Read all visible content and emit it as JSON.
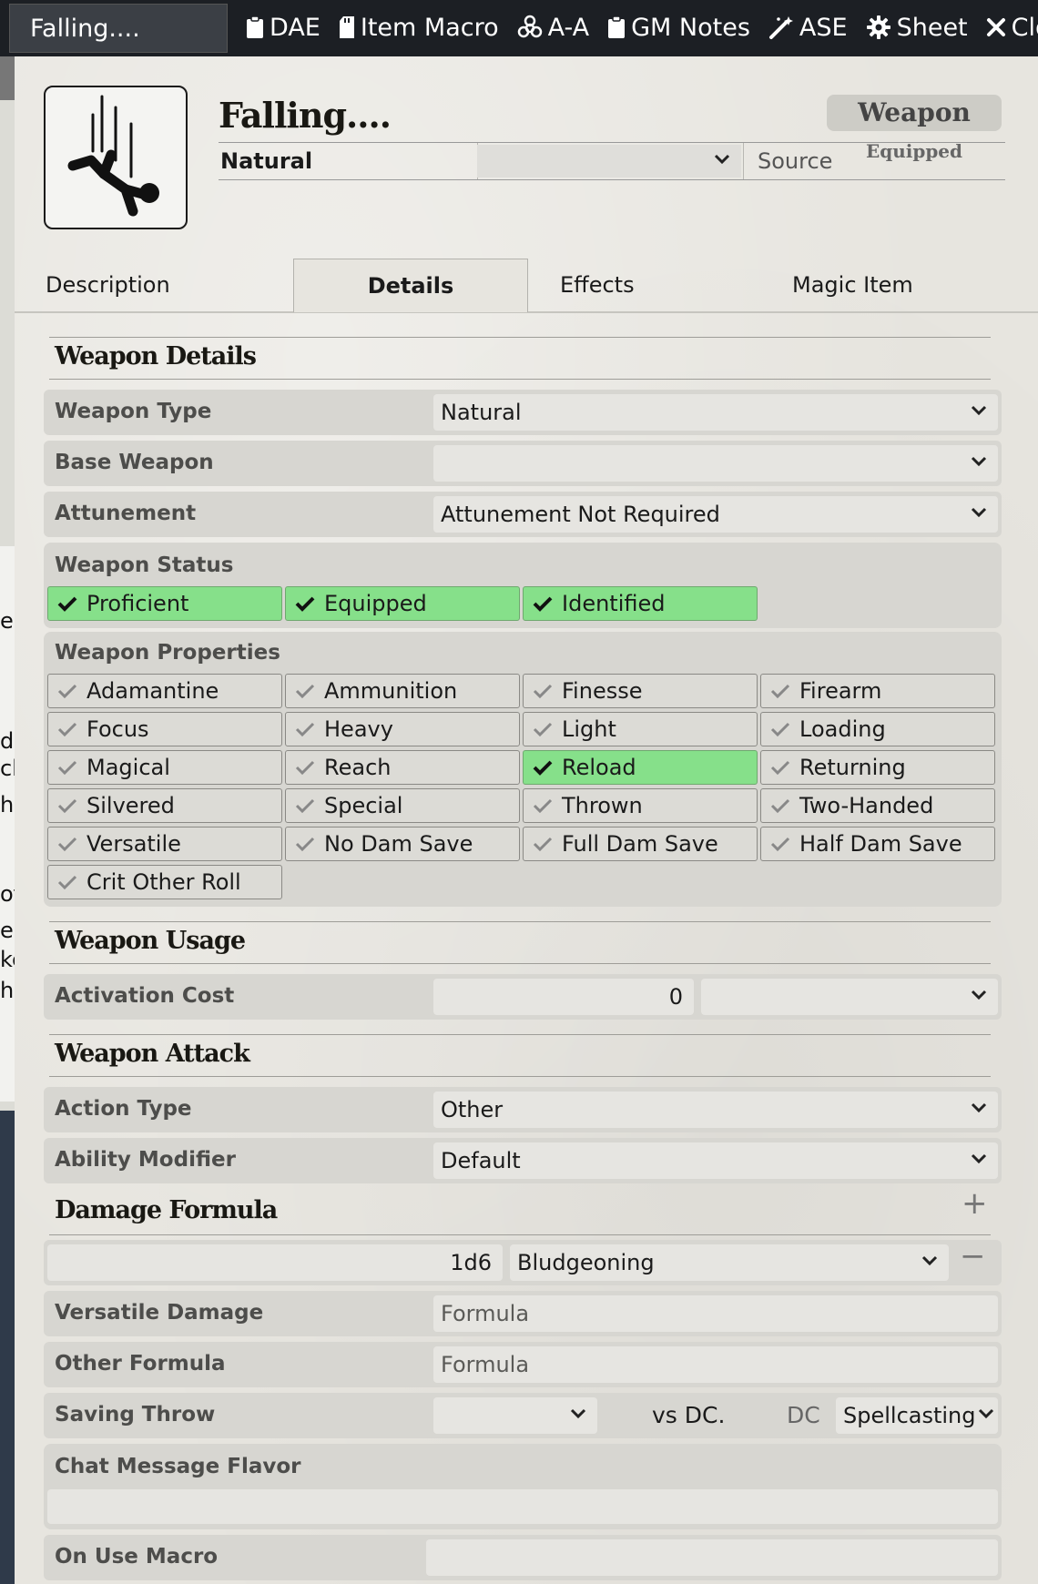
{
  "window": {
    "title": "Falling....",
    "header_buttons": [
      {
        "label": "DAE",
        "icon": "clipboard-icon"
      },
      {
        "label": "Item Macro",
        "icon": "sd-card-icon"
      },
      {
        "label": "A-A",
        "icon": "biohazard-icon"
      },
      {
        "label": "GM Notes",
        "icon": "clipboard-icon"
      },
      {
        "label": "ASE",
        "icon": "magic-wand-icon"
      },
      {
        "label": "Sheet",
        "icon": "gear-icon"
      },
      {
        "label": "Close",
        "icon": "close-icon"
      }
    ]
  },
  "background": {
    "fragments": [
      "e",
      "di",
      "ch",
      "he",
      "ot",
      "e.",
      "ke",
      "hu"
    ]
  },
  "item": {
    "name": "Falling....",
    "type_label": "Weapon",
    "status_label": "Equipped",
    "subtype": "Natural",
    "rarity_value": "",
    "source_placeholder": "Source",
    "portrait_icon": "falling-person-icon"
  },
  "tabs": [
    {
      "label": "Description",
      "active": false
    },
    {
      "label": "Details",
      "active": true
    },
    {
      "label": "Effects",
      "active": false
    },
    {
      "label": "Magic Item",
      "active": false
    }
  ],
  "weapon_details": {
    "title": "Weapon Details",
    "weapon_type": {
      "label": "Weapon Type",
      "value": "Natural"
    },
    "base_weapon": {
      "label": "Base Weapon",
      "value": ""
    },
    "attunement": {
      "label": "Attunement",
      "value": "Attunement Not Required"
    },
    "status": {
      "label": "Weapon Status",
      "items": [
        {
          "label": "Proficient",
          "checked": true
        },
        {
          "label": "Equipped",
          "checked": true
        },
        {
          "label": "Identified",
          "checked": true
        }
      ]
    },
    "properties": {
      "label": "Weapon Properties",
      "items": [
        {
          "label": "Adamantine",
          "checked": false
        },
        {
          "label": "Ammunition",
          "checked": false
        },
        {
          "label": "Finesse",
          "checked": false
        },
        {
          "label": "Firearm",
          "checked": false
        },
        {
          "label": "Focus",
          "checked": false
        },
        {
          "label": "Heavy",
          "checked": false
        },
        {
          "label": "Light",
          "checked": false
        },
        {
          "label": "Loading",
          "checked": false
        },
        {
          "label": "Magical",
          "checked": false
        },
        {
          "label": "Reach",
          "checked": false
        },
        {
          "label": "Reload",
          "checked": true
        },
        {
          "label": "Returning",
          "checked": false
        },
        {
          "label": "Silvered",
          "checked": false
        },
        {
          "label": "Special",
          "checked": false
        },
        {
          "label": "Thrown",
          "checked": false
        },
        {
          "label": "Two-Handed",
          "checked": false
        },
        {
          "label": "Versatile",
          "checked": false
        },
        {
          "label": "No Dam Save",
          "checked": false
        },
        {
          "label": "Full Dam Save",
          "checked": false
        },
        {
          "label": "Half Dam Save",
          "checked": false
        },
        {
          "label": "Crit Other Roll",
          "checked": false
        }
      ]
    }
  },
  "weapon_usage": {
    "title": "Weapon Usage",
    "activation_cost": {
      "label": "Activation Cost",
      "value": "0",
      "type_value": ""
    }
  },
  "weapon_attack": {
    "title": "Weapon Attack",
    "action_type": {
      "label": "Action Type",
      "value": "Other"
    },
    "ability_modifier": {
      "label": "Ability Modifier",
      "value": "Default"
    }
  },
  "damage": {
    "title": "Damage Formula",
    "add_symbol": "+",
    "parts": [
      {
        "formula": "1d6",
        "type": "Bludgeoning",
        "remove_symbol": "−"
      }
    ],
    "versatile": {
      "label": "Versatile Damage",
      "placeholder": "Formula"
    },
    "other": {
      "label": "Other Formula",
      "placeholder": "Formula"
    },
    "saving_throw": {
      "label": "Saving Throw",
      "ability_value": "",
      "vs_text": "vs DC.",
      "dc_label": "DC",
      "dc_value": "Spellcasting"
    },
    "chat_flavor": {
      "label": "Chat Message Flavor",
      "value": ""
    },
    "on_use_macro": {
      "label": "On Use Macro",
      "value": ""
    }
  },
  "colors": {
    "checked": "#86e08a",
    "sheet": "#e7e5df",
    "header": "#1c1f24"
  }
}
